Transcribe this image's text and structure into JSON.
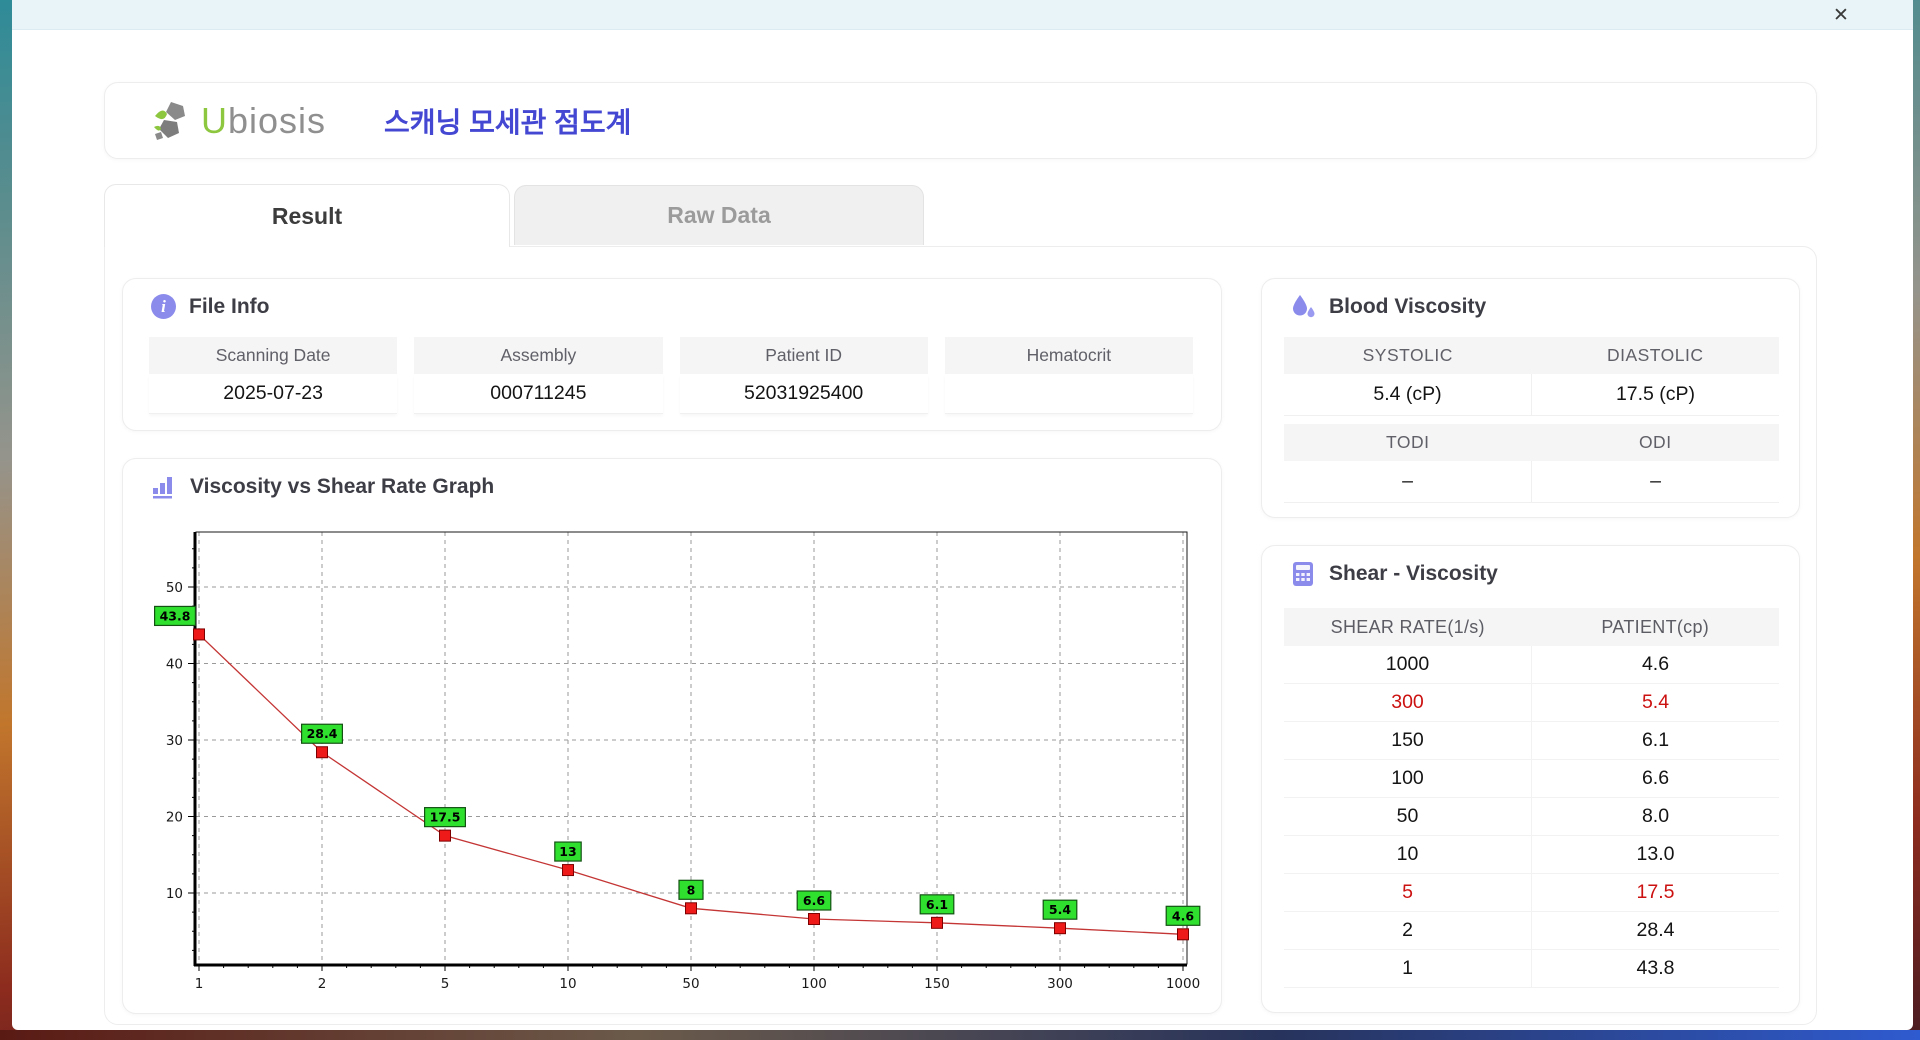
{
  "window": {
    "close": "✕"
  },
  "header": {
    "logo_u": "U",
    "logo_rest": "biosis",
    "title_ko": "스캐닝 모세관 점도계"
  },
  "tabs": [
    {
      "label": "Result",
      "active": true
    },
    {
      "label": "Raw Data",
      "active": false
    }
  ],
  "file_info": {
    "section_title": "File Info",
    "fields": [
      {
        "label": "Scanning Date",
        "value": "2025-07-23"
      },
      {
        "label": "Assembly",
        "value": "000711245"
      },
      {
        "label": "Patient ID",
        "value": "52031925400"
      },
      {
        "label": "Hematocrit",
        "value": ""
      }
    ]
  },
  "blood_viscosity": {
    "section_title": "Blood Viscosity",
    "rows": [
      {
        "labels": [
          "SYSTOLIC",
          "DIASTOLIC"
        ],
        "values": [
          "5.4 (cP)",
          "17.5 (cP)"
        ]
      },
      {
        "labels": [
          "TODI",
          "ODI"
        ],
        "values": [
          "–",
          "–"
        ]
      }
    ]
  },
  "graph": {
    "section_title": "Viscosity vs Shear Rate Graph"
  },
  "chart_data": {
    "type": "line",
    "title": "Viscosity vs Shear Rate Graph",
    "xlabel": "",
    "ylabel": "",
    "x_axis_type": "categorical-equal-spacing",
    "x": [
      1,
      2,
      5,
      10,
      50,
      100,
      150,
      300,
      1000
    ],
    "x_labels": [
      "1",
      "2",
      "5",
      "10",
      "50",
      "100",
      "150",
      "300",
      "1000"
    ],
    "series": [
      {
        "name": "PATIENT",
        "values": [
          43.8,
          28.4,
          17.5,
          13,
          8,
          6.6,
          6.1,
          5.4,
          4.6
        ]
      }
    ],
    "point_labels": [
      "43.8",
      "28.4",
      "17.5",
      "13",
      "8",
      "6.6",
      "6.1",
      "5.4",
      "4.6"
    ],
    "yticks": [
      10,
      20,
      30,
      40,
      50
    ],
    "ylim": [
      0,
      57
    ],
    "grid": true,
    "line_color": "#c43535",
    "marker_color": "#ee1a1a",
    "marker_edge_color": "#7d0000",
    "label_bg": "#2fe02f",
    "label_border": "#145214"
  },
  "shear_viscosity": {
    "section_title": "Shear - Viscosity",
    "columns": [
      "SHEAR RATE(1/s)",
      "PATIENT(cp)"
    ],
    "rows": [
      {
        "shear_rate": "1000",
        "patient": "4.6",
        "highlight": false
      },
      {
        "shear_rate": "300",
        "patient": "5.4",
        "highlight": true
      },
      {
        "shear_rate": "150",
        "patient": "6.1",
        "highlight": false
      },
      {
        "shear_rate": "100",
        "patient": "6.6",
        "highlight": false
      },
      {
        "shear_rate": "50",
        "patient": "8.0",
        "highlight": false
      },
      {
        "shear_rate": "10",
        "patient": "13.0",
        "highlight": false
      },
      {
        "shear_rate": "5",
        "patient": "17.5",
        "highlight": true
      },
      {
        "shear_rate": "2",
        "patient": "28.4",
        "highlight": false
      },
      {
        "shear_rate": "1",
        "patient": "43.8",
        "highlight": false
      }
    ]
  },
  "colors": {
    "accent_purple": "#8b8bec",
    "title_blue": "#4347d2",
    "highlight_red": "#cc1111",
    "logo_green": "#8dc63f",
    "titlebar": "#e9f4f8"
  }
}
